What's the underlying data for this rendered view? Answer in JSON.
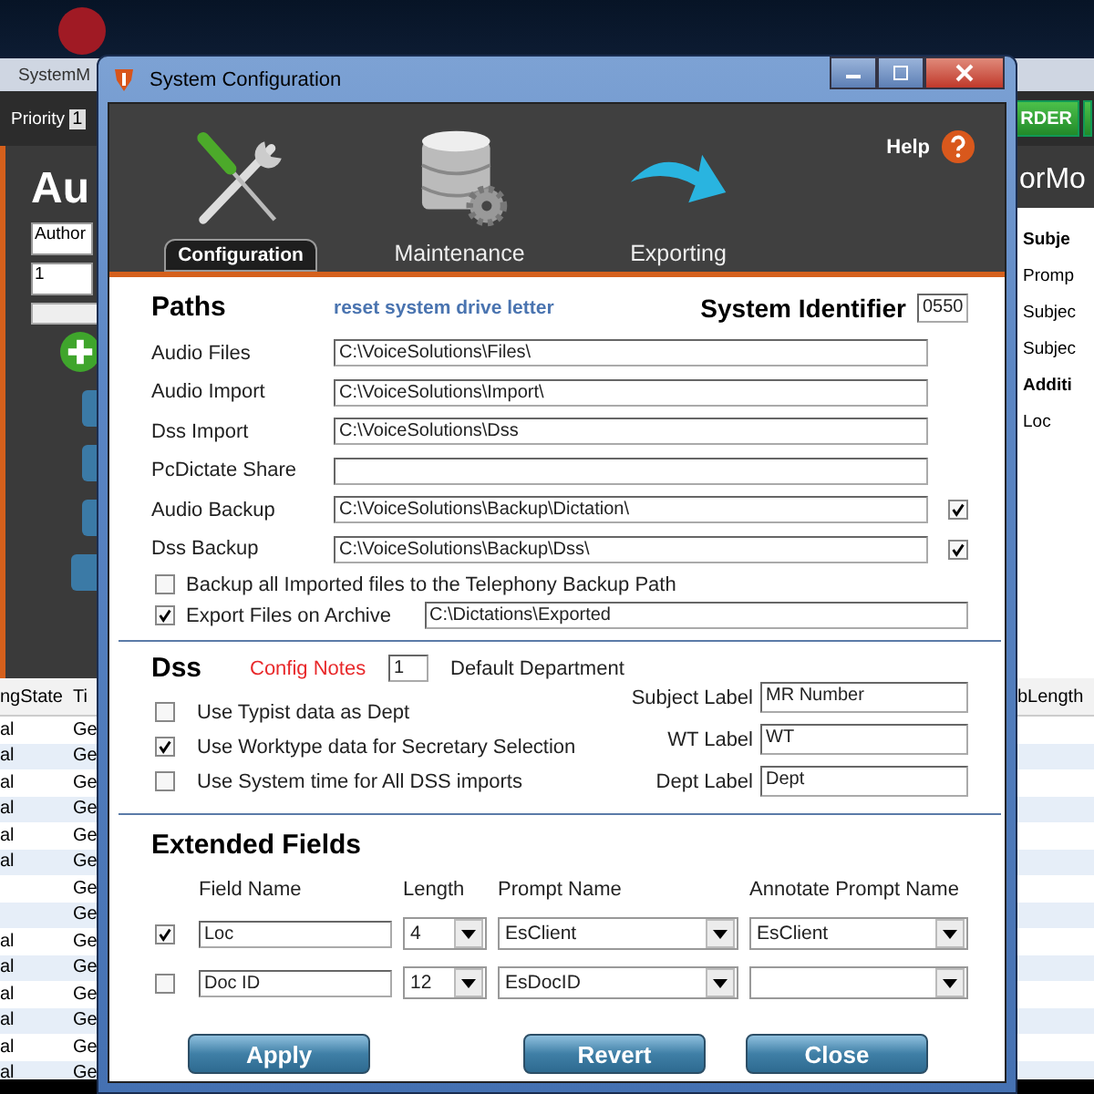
{
  "background_app": {
    "title": "SystemM",
    "toolbar": {
      "priority_label": "Priority",
      "priority_value": "1",
      "order_button": "RDER"
    },
    "heading_left": "Au",
    "heading_right": "orMo",
    "author_field": "Author",
    "number_field": "1",
    "side_panel": {
      "subject_heading": "Subje",
      "lines": [
        "Promp",
        "Subjec",
        "Subjec"
      ],
      "additional_heading": "Additi",
      "additional_lines": [
        "Loc"
      ]
    },
    "table": {
      "columns": [
        "ngState",
        "Ti"
      ],
      "right_column": "bLength",
      "rows": [
        {
          "column_1": "al",
          "column_2": "Ge"
        },
        {
          "column_1": "al",
          "column_2": "Ge"
        },
        {
          "column_1": "al",
          "column_2": "Ge"
        },
        {
          "column_1": "al",
          "column_2": "Ge"
        },
        {
          "column_1": "al",
          "column_2": "Ge"
        },
        {
          "column_1": "al",
          "column_2": "Ge"
        },
        {
          "column_2": "Ge"
        },
        {
          "column_2": "Ge"
        },
        {
          "column_1": "al",
          "column_2": "Ge"
        },
        {
          "column_1": "al",
          "column_2": "Ge"
        },
        {
          "column_1": "al",
          "column_2": "Ge"
        },
        {
          "column_1": "al",
          "column_2": "Ge"
        },
        {
          "column_1": "al",
          "column_2": "Ge"
        },
        {
          "column_1": "al",
          "column_2": "Ge"
        }
      ]
    }
  },
  "window": {
    "title": "System Configuration",
    "help": "Help",
    "tabs": [
      {
        "label": "Configuration",
        "kind": "tools",
        "selected": true
      },
      {
        "label": "Maintenance",
        "kind": "database",
        "selected": false
      },
      {
        "label": "Exporting",
        "kind": "arrow",
        "selected": false
      }
    ],
    "paths": {
      "heading": "Paths",
      "reset_link": "reset system drive letter",
      "system_identifier_label": "System Identifier",
      "system_identifier": "0550",
      "fields": [
        {
          "label": "Audio Files",
          "value": "C:\\VoiceSolutions\\Files\\"
        },
        {
          "label": "Audio Import",
          "value": "C:\\VoiceSolutions\\Import\\"
        },
        {
          "label": "Dss Import",
          "value": "C:\\VoiceSolutions\\Dss"
        },
        {
          "label": "PcDictate Share"
        },
        {
          "label": "Audio Backup",
          "value": "C:\\VoiceSolutions\\Backup\\Dictation\\",
          "checked": true
        },
        {
          "label": "Dss Backup",
          "value": "C:\\VoiceSolutions\\Backup\\Dss\\",
          "checked": true
        }
      ],
      "options": [
        {
          "label": "Backup all Imported files to the Telephony Backup Path",
          "checked": false
        },
        {
          "label": "Export Files on Archive",
          "checked": true,
          "value": "C:\\Dictations\\Exported"
        }
      ]
    },
    "dss": {
      "heading": "Dss",
      "config_notes_link": "Config Notes",
      "default_department": "1",
      "default_department_label": "Default Department",
      "options": [
        {
          "label": "Use Typist data as Dept",
          "checked": false
        },
        {
          "label": "Use Worktype data for Secretary Selection",
          "checked": true
        },
        {
          "label": "Use System time for All DSS imports",
          "checked": false
        }
      ],
      "labels": [
        {
          "label": "Subject Label",
          "value": "MR Number"
        },
        {
          "label": "WT Label",
          "value": "WT"
        },
        {
          "label": "Dept Label",
          "value": "Dept"
        }
      ]
    },
    "extended_fields": {
      "heading": "Extended Fields",
      "columns": [
        "Field Name",
        "Length",
        "Prompt Name",
        "Annotate Prompt Name"
      ],
      "rows": [
        {
          "checked": true,
          "field_name": "Loc",
          "length": "4",
          "prompt_name": "EsClient",
          "annotate_prompt_name": "EsClient"
        },
        {
          "checked": false,
          "field_name": "Doc ID",
          "length": "12",
          "prompt_name": "EsDocID"
        }
      ]
    },
    "buttons": {
      "apply": "Apply",
      "revert": "Revert",
      "close": "Close"
    }
  }
}
